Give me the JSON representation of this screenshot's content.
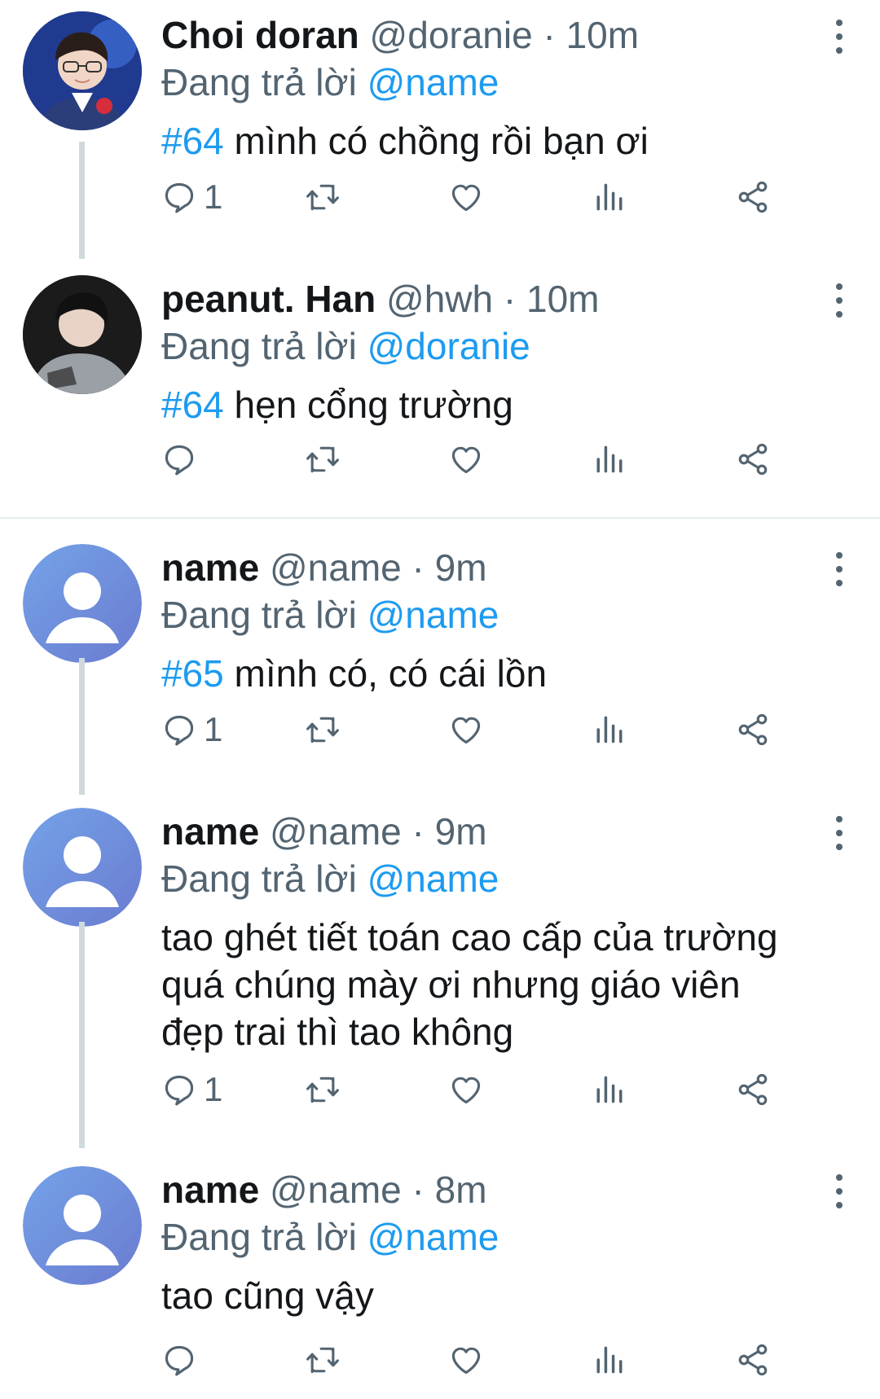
{
  "tweets": [
    {
      "name": "Choi doran",
      "handle": "@doranie",
      "dot": "·",
      "time": "10m",
      "reply_prefix": "Đang trả lời",
      "reply_to": "@name",
      "tag": "#64",
      "text": "mình có chồng rồi bạn ơi",
      "reply_count": "1",
      "avatar": "photo-avatar-boy-glasses"
    },
    {
      "name": "peanut. Han",
      "handle": "@hwh",
      "dot": "·",
      "time": "10m",
      "reply_prefix": "Đang trả lời",
      "reply_to": "@doranie",
      "tag": "#64",
      "text": "hẹn cổng trường",
      "reply_count": "",
      "avatar": "photo-avatar-grey-hoodie"
    },
    {
      "name": "name",
      "handle": "@name",
      "dot": "·",
      "time": "9m",
      "reply_prefix": "Đang trả lời",
      "reply_to": "@name",
      "tag": "#65",
      "text": "mình có, có cái lồn",
      "reply_count": "1",
      "avatar": "default-user-avatar"
    },
    {
      "name": "name",
      "handle": "@name",
      "dot": "·",
      "time": "9m",
      "reply_prefix": "Đang trả lời",
      "reply_to": "@name",
      "tag": "",
      "text_lines": [
        "tao ghét tiết toán cao cấp của trường",
        "quá chúng mày ơi nhưng giáo viên",
        "đẹp trai thì tao không"
      ],
      "reply_count": "1",
      "avatar": "default-user-avatar"
    },
    {
      "name": "name",
      "handle": "@name",
      "dot": "·",
      "time": "8m",
      "reply_prefix": "Đang trả lời",
      "reply_to": "@name",
      "tag": "",
      "text": "tao cũng vậy",
      "reply_count": "",
      "avatar": "default-user-avatar"
    }
  ],
  "icons": [
    "reply-icon",
    "retweet-icon",
    "like-icon",
    "views-icon",
    "share-icon",
    "more-options-icon"
  ],
  "colors": {
    "accent": "#1d9bf0",
    "muted": "#536471",
    "text": "#14171a",
    "thread_line": "#cfd9de",
    "default_avatar": "#6a8fd6"
  }
}
